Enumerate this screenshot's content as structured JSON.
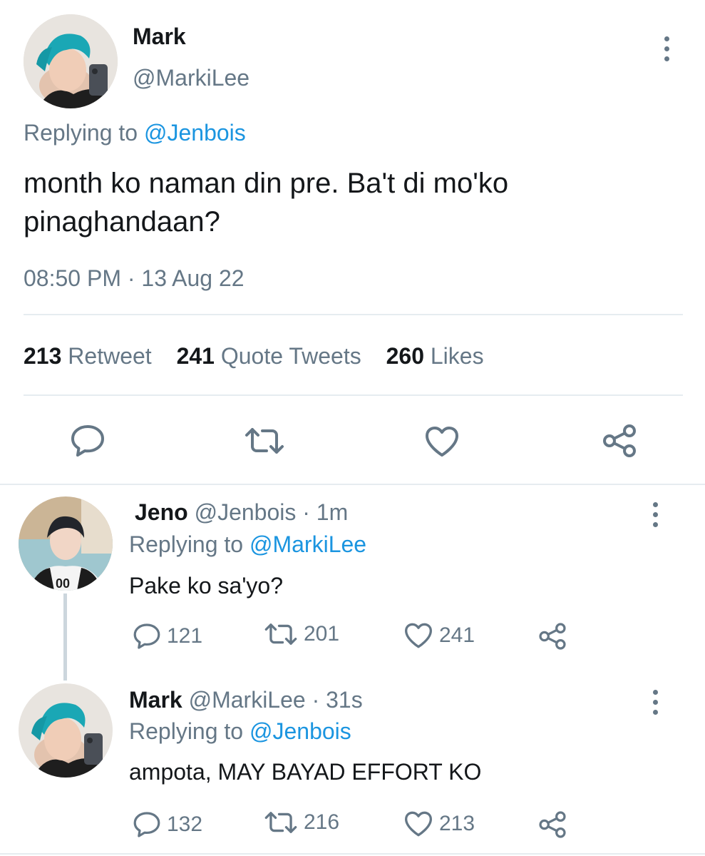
{
  "main_tweet": {
    "name": "Mark",
    "handle": "@MarkiLee",
    "replying_prefix": "Replying to",
    "replying_to": "@Jenbois",
    "text_line1": "month ko naman din pre. Ba't di mo'ko",
    "text_line2": "pinaghandaan?",
    "timestamp": "08:50 PM · 13 Aug 22",
    "stats": {
      "retweets_count": "213",
      "retweets_label": "Retweet",
      "quotes_count": "241",
      "quotes_label": "Quote Tweets",
      "likes_count": "260",
      "likes_label": "Likes"
    },
    "actions": [
      "reply-icon",
      "retweet-icon",
      "like-icon",
      "share-icon"
    ]
  },
  "replies": [
    {
      "name": "Jeno",
      "handle": "@Jenbois",
      "time": "· 1m",
      "replying_prefix": "Replying to",
      "replying_to": "@MarkiLee",
      "text": "Pake ko sa'yo?",
      "reply_count": "121",
      "retweet_count": "201",
      "like_count": "241"
    },
    {
      "name": "Mark",
      "handle": "@MarkiLee",
      "time": "· 31s",
      "replying_prefix": "Replying to",
      "replying_to": "@Jenbois",
      "text": "ampota, MAY BAYAD EFFORT KO",
      "reply_count": "132",
      "retweet_count": "216",
      "like_count": "213"
    }
  ],
  "colors": {
    "link": "#1b95e0",
    "muted": "#657786",
    "text": "#14171a",
    "divider": "#e6ecf0"
  }
}
